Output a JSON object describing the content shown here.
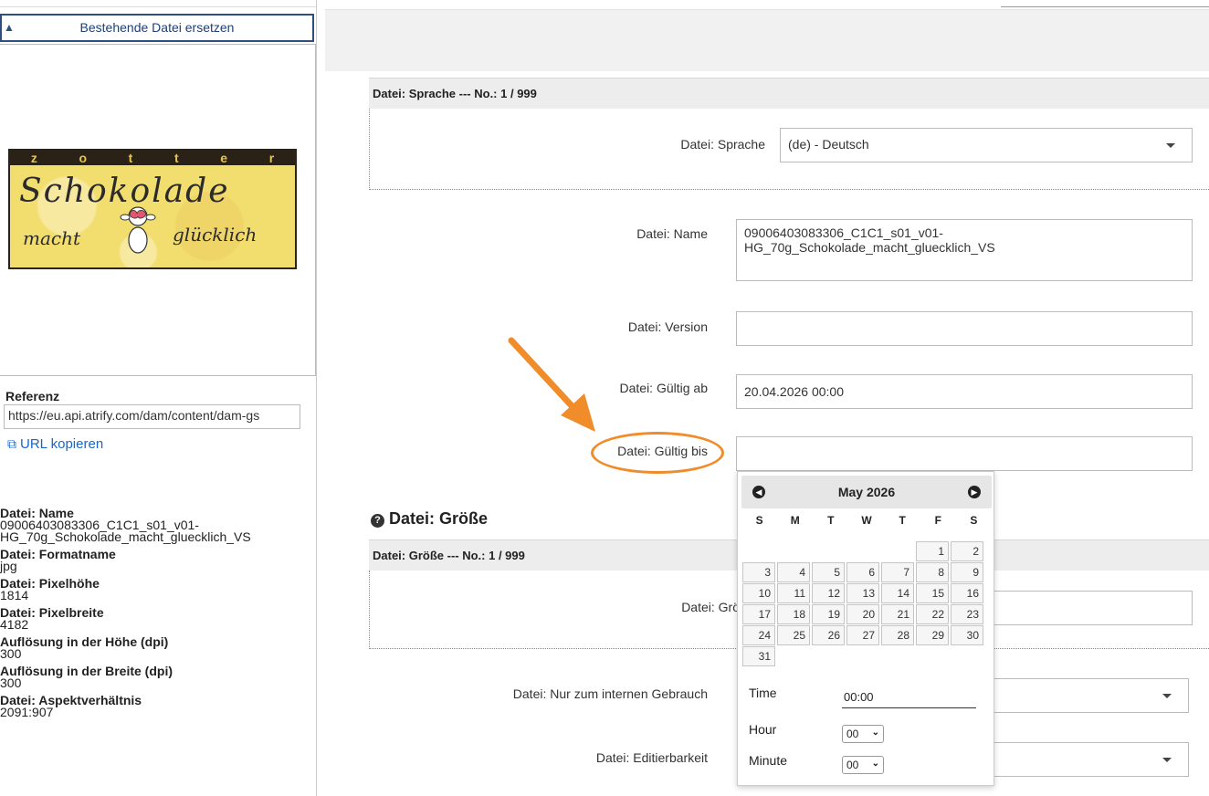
{
  "left_panel": {
    "replace_button": "Bestehende Datei ersetzen",
    "preview": {
      "brand_letters": [
        "z",
        "o",
        "t",
        "t",
        "e",
        "r"
      ],
      "script_line1": "Schokolade",
      "script_line2": "macht",
      "script_line3": "glücklich"
    },
    "reference_label": "Referenz",
    "reference_value": "https://eu.api.atrify.com/dam/content/dam-gs",
    "copy_url": "URL kopieren",
    "meta": [
      {
        "label": "Datei: Name",
        "value": "09006403083306_C1C1_s01_v01-\nHG_70g_Schokolade_macht_gluecklich_VS"
      },
      {
        "label": "Datei: Formatname",
        "value": "jpg"
      },
      {
        "label": "Datei: Pixelhöhe",
        "value": "1814"
      },
      {
        "label": "Datei: Pixelbreite",
        "value": "4182"
      },
      {
        "label": "Auflösung in der Höhe (dpi)",
        "value": "300"
      },
      {
        "label": "Auflösung in der Breite (dpi)",
        "value": "300"
      },
      {
        "label": "Datei: Aspektverhältnis",
        "value": "2091:907"
      }
    ]
  },
  "form": {
    "language_section_title": "Datei: Sprache --- No.: 1 / 999",
    "language_label": "Datei: Sprache",
    "language_value": "(de) - Deutsch",
    "name_label": "Datei: Name",
    "name_value": "09006403083306_C1C1_s01_v01-\nHG_70g_Schokolade_macht_gluecklich_VS",
    "version_label": "Datei: Version",
    "version_value": "",
    "valid_from_label": "Datei: Gültig ab",
    "valid_from_value": "20.04.2026 00:00",
    "valid_to_label": "Datei: Gültig bis",
    "valid_to_value": "",
    "size_heading": "Datei: Größe",
    "size_section_title": "Datei: Größe --- No.: 1 / 999",
    "size_label": "Datei: Grö",
    "internal_label": "Datei: Nur zum internen Gebrauch",
    "editable_label": "Datei: Editierbarkeit"
  },
  "datepicker": {
    "title": "May 2026",
    "weekdays": [
      "S",
      "M",
      "T",
      "W",
      "T",
      "F",
      "S"
    ],
    "weeks": [
      [
        "",
        "",
        "",
        "",
        "",
        "1",
        "2"
      ],
      [
        "3",
        "4",
        "5",
        "6",
        "7",
        "8",
        "9"
      ],
      [
        "10",
        "11",
        "12",
        "13",
        "14",
        "15",
        "16"
      ],
      [
        "17",
        "18",
        "19",
        "20",
        "21",
        "22",
        "23"
      ],
      [
        "24",
        "25",
        "26",
        "27",
        "28",
        "29",
        "30"
      ],
      [
        "31",
        "",
        "",
        "",
        "",
        "",
        ""
      ]
    ],
    "time_label": "Time",
    "time_value": "00:00",
    "hour_label": "Hour",
    "hour_value": "00",
    "minute_label": "Minute",
    "minute_value": "00"
  },
  "colors": {
    "annotation": "#f08c2a",
    "link": "#1a66c4",
    "button_border": "#2d4f80"
  }
}
